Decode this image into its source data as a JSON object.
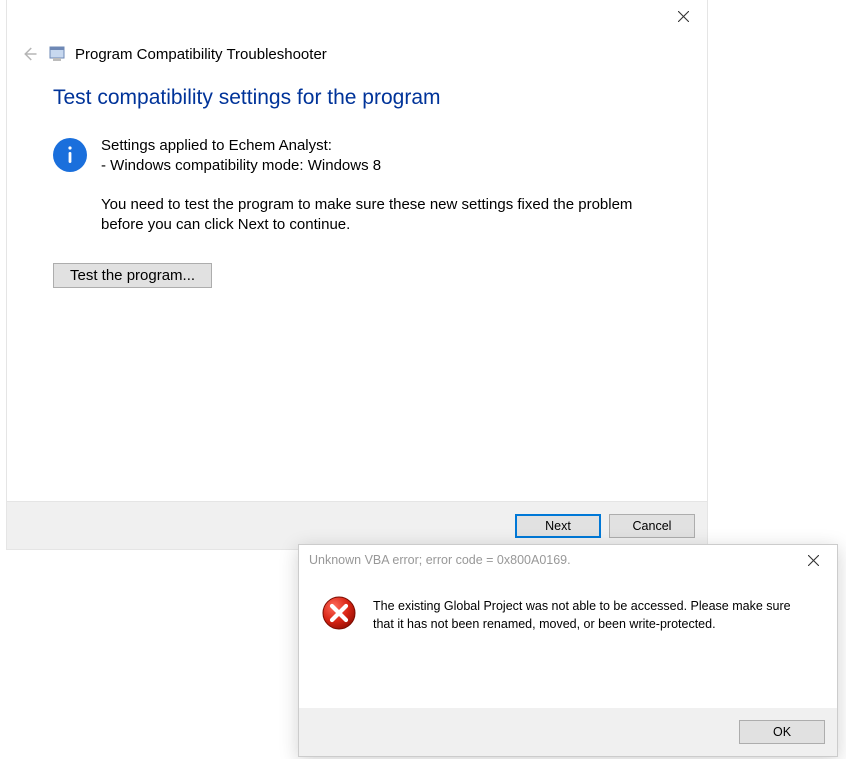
{
  "wizard": {
    "window_title": "Program Compatibility Troubleshooter",
    "heading": "Test compatibility settings for the program",
    "info_line1": "Settings applied to Echem Analyst:",
    "info_line2": "- Windows compatibility mode: Windows 8",
    "info_line3": "You need to test the program to make sure these new settings fixed the problem before you can click Next to continue.",
    "test_button": "Test the program...",
    "next_button": "Next",
    "cancel_button": "Cancel"
  },
  "dialog": {
    "title": "Unknown VBA error; error code = 0x800A0169.",
    "message": "The existing Global Project was not able to be accessed.  Please make sure that it has not been renamed, moved, or been write-protected.",
    "ok_button": "OK"
  }
}
